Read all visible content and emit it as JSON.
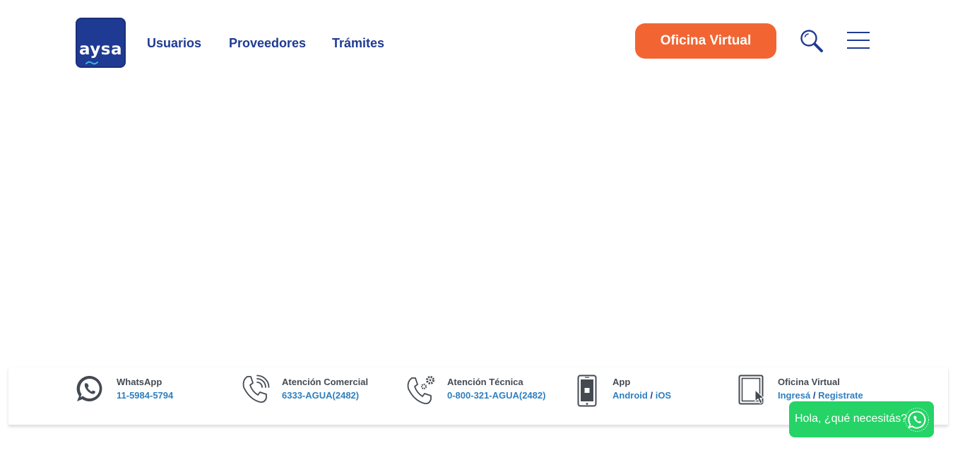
{
  "brand": {
    "logo_text": "aysa",
    "color": "#1f3a93",
    "accent": "#f26533"
  },
  "nav": {
    "items": [
      {
        "label": "Usuarios"
      },
      {
        "label": "Proveedores"
      },
      {
        "label": "Trámites"
      }
    ],
    "cta_label": "Oficina Virtual",
    "search_icon": "search-icon",
    "menu_icon": "hamburger-menu-icon"
  },
  "contacts": {
    "whatsapp": {
      "title": "WhatsApp",
      "value": "11-5984-5794",
      "icon": "whatsapp-icon"
    },
    "comercial": {
      "title": "Atención Comercial",
      "value": "6333-AGUA(2482)",
      "icon": "phone-icon"
    },
    "tecnica": {
      "title": "Atención Técnica",
      "value": "0-800-321-AGUA(2482)",
      "icon": "phone-gear-icon"
    },
    "app": {
      "title": "App",
      "link1": "Android",
      "sep": "/",
      "link2": "iOS",
      "icon": "smartphone-icon"
    },
    "oficina": {
      "title": "Oficina Virtual",
      "link1": "Ingresá",
      "sep": "/",
      "link2": "Registrate",
      "icon": "tablet-cursor-icon"
    }
  },
  "whatsapp_chat": {
    "label": "Hola, ¿qué necesitás?",
    "color": "#25d366",
    "icon": "whatsapp-icon"
  }
}
